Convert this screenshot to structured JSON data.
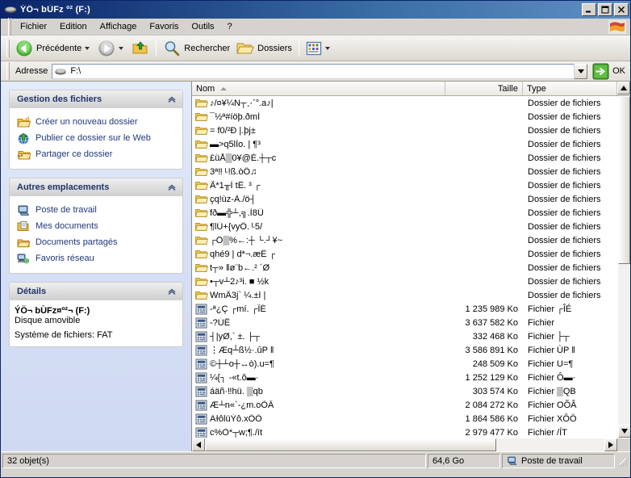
{
  "window": {
    "title": "ÝÖ¬ bÙFz º² (F:)",
    "title_icon": "removable-drive-icon",
    "minimize_label": "_",
    "maximize_label": "□",
    "close_label": "✕"
  },
  "menu": {
    "items": [
      {
        "label": "Fichier"
      },
      {
        "label": "Edition"
      },
      {
        "label": "Affichage"
      },
      {
        "label": "Favoris"
      },
      {
        "label": "Outils"
      },
      {
        "label": "?"
      }
    ]
  },
  "toolbar": {
    "back_label": "Précédente",
    "forward_label": "",
    "up_label": "",
    "search_label": "Rechercher",
    "folders_label": "Dossiers",
    "views_label": ""
  },
  "address": {
    "label": "Adresse",
    "value": "F:\\",
    "go_label": "OK"
  },
  "sidebar": {
    "panels": [
      {
        "title": "Gestion des fichiers",
        "type": "links",
        "items": [
          {
            "label": "Créer un nouveau dossier",
            "icon": "new-folder-icon"
          },
          {
            "label": "Publier ce dossier sur le Web",
            "icon": "publish-web-icon"
          },
          {
            "label": "Partager ce dossier",
            "icon": "share-folder-icon"
          }
        ]
      },
      {
        "title": "Autres emplacements",
        "type": "links",
        "items": [
          {
            "label": "Poste de travail",
            "icon": "my-computer-icon"
          },
          {
            "label": "Mes documents",
            "icon": "my-documents-icon"
          },
          {
            "label": "Documents partagés",
            "icon": "shared-documents-icon"
          },
          {
            "label": "Favoris réseau",
            "icon": "network-places-icon"
          }
        ]
      },
      {
        "title": "Détails",
        "type": "details",
        "name": "ÝÖ¬ bÙFz¤º²¬ (F:)",
        "kind": "Disque amovible",
        "filesystem": "Système de fichiers: FAT"
      }
    ]
  },
  "filelist": {
    "columns": [
      {
        "label": "Nom",
        "sort": "asc"
      },
      {
        "label": "Taille"
      },
      {
        "label": "Type"
      }
    ],
    "rows": [
      {
        "icon": "folder-icon",
        "name": "♪/¤¥¼N┬⋰°.a♪|",
        "size": "",
        "type": "Dossier de fichiers"
      },
      {
        "icon": "folder-icon",
        "name": "¯½ª#íöþ.ðmÌ",
        "size": "",
        "type": "Dossier de fichiers"
      },
      {
        "icon": "folder-icon",
        "name": "= f0/²Ð |.þj±",
        "size": "",
        "type": "Dossier de fichiers"
      },
      {
        "icon": "folder-icon",
        "name": "▬>q5lÌo. | ¶³",
        "size": "",
        "type": "Dossier de fichiers"
      },
      {
        "icon": "folder-icon",
        "name": "£üÅ▒0¥@É.┼┬c",
        "size": "",
        "type": "Dossier de fichiers"
      },
      {
        "icon": "folder-icon",
        "name": "3ª‼ ᴸ!ß.òÖ♫",
        "size": "",
        "type": "Dossier de fichiers"
      },
      {
        "icon": "folder-icon",
        "name": "Ã*1╥Ì tË. ³ ┌",
        "size": "",
        "type": "Dossier de fichiers"
      },
      {
        "icon": "folder-icon",
        "name": "çq!ùz-À./ö┤",
        "size": "",
        "type": "Dossier de fichiers"
      },
      {
        "icon": "folder-icon",
        "name": "fð▬╬┴,╗.Ì8Ü",
        "size": "",
        "type": "Dossier de fichiers"
      },
      {
        "icon": "folder-icon",
        "name": "¶lÚ+{vyÔ. ᴸ5/",
        "size": "",
        "type": "Dossier de fichiers"
      },
      {
        "icon": "folder-icon",
        "name": " ┌Ô▒%←:┼ └.┘¥~",
        "size": "",
        "type": "Dossier de fichiers"
      },
      {
        "icon": "folder-icon",
        "name": "qhé9 | d*¬.æË ┌",
        "size": "",
        "type": "Dossier de fichiers"
      },
      {
        "icon": "folder-icon",
        "name": "t┬» ‖ø¨b←.² ´Ø",
        "size": "",
        "type": "Dossier de fichiers"
      },
      {
        "icon": "folder-icon",
        "name": "•┬v┴2♪³i. ■ ½k",
        "size": "",
        "type": "Dossier de fichiers"
      },
      {
        "icon": "folder-icon",
        "name": "WmÂ3j` ¼.±Í |",
        "size": "",
        "type": "Dossier de fichiers"
      },
      {
        "icon": "file-icon",
        "name": "-ª¿Ç ┌mí. ┌ÎÉ",
        "size": "1 235 989 Ko",
        "type": "Fichier  ┌ÎÉ"
      },
      {
        "icon": "file-icon",
        "name": "-?ÚÊ",
        "size": "3 637 582 Ko",
        "type": "Fichier"
      },
      {
        "icon": "file-icon",
        "name": "┤|yØ,` ±. ├┬",
        "size": "332 468 Ko",
        "type": "Fichier  ├┬"
      },
      {
        "icon": "file-icon",
        "name": "⋮Æq┴ß½·.ûP ‖",
        "size": "3 586 891 Ko",
        "type": "Fichier ÙP ‖"
      },
      {
        "icon": "file-icon",
        "name": "©┼┴o┼↔ò).u=¶",
        "size": "248 509 Ko",
        "type": "Fichier U=¶"
      },
      {
        "icon": "file-icon",
        "name": "¼{┐ -«t.ô▬·",
        "size": "1 252 129 Ko",
        "type": "Fichier Ô▬·"
      },
      {
        "icon": "file-icon",
        "name": "áäñ·‼hü. ▒qb",
        "size": "303 574 Ko",
        "type": "Fichier ▒QB"
      },
      {
        "icon": "file-icon",
        "name": "Æ┴n«`-¿m.oÕÂ",
        "size": "2 084 272 Ko",
        "type": "Fichier OÕÂ"
      },
      {
        "icon": "file-icon",
        "name": "AɫôlüÝô.xÔÖ",
        "size": "1 864 586 Ko",
        "type": "Fichier XÔÖ"
      },
      {
        "icon": "file-icon",
        "name": "c%Ò*┬w;¶./ít",
        "size": "2 979 477 Ko",
        "type": "Fichier /ÍT"
      }
    ]
  },
  "statusbar": {
    "count": "32 objet(s)",
    "size": "64,6 Go",
    "place": "Poste de travail",
    "place_icon": "my-computer-icon"
  }
}
